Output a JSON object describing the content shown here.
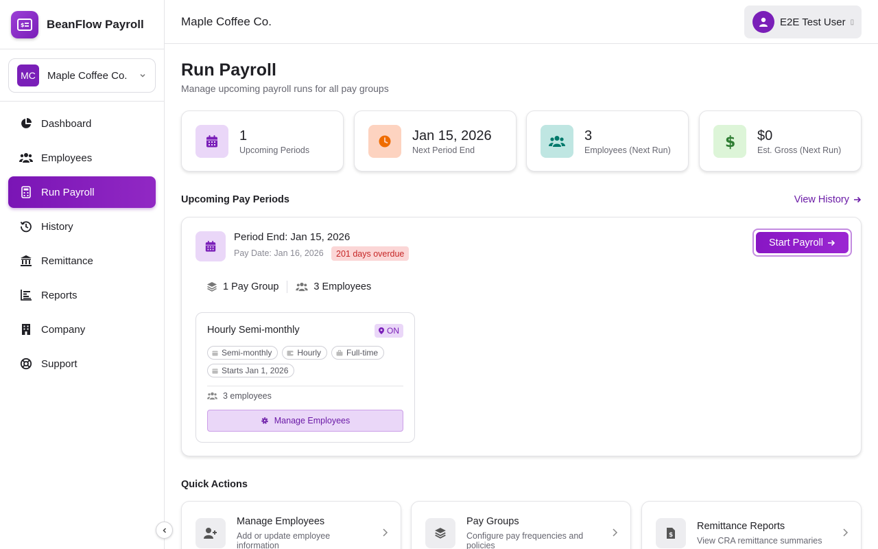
{
  "brand": {
    "name": "BeanFlow Payroll",
    "logo_icon": "payroll-card-icon"
  },
  "company_selector": {
    "initials": "MC",
    "name": "Maple Coffee Co."
  },
  "nav": {
    "items": [
      {
        "label": "Dashboard",
        "icon": "pie-chart-icon",
        "active": false
      },
      {
        "label": "Employees",
        "icon": "users-icon",
        "active": false
      },
      {
        "label": "Run Payroll",
        "icon": "calculator-icon",
        "active": true
      },
      {
        "label": "History",
        "icon": "history-icon",
        "active": false
      },
      {
        "label": "Remittance",
        "icon": "bank-icon",
        "active": false
      },
      {
        "label": "Reports",
        "icon": "bar-chart-icon",
        "active": false
      },
      {
        "label": "Company",
        "icon": "building-icon",
        "active": false
      },
      {
        "label": "Support",
        "icon": "lifebuoy-icon",
        "active": false
      }
    ]
  },
  "header": {
    "title": "Maple Coffee Co.",
    "user_name": "E2E Test User",
    "user_caret": "▯"
  },
  "page": {
    "title": "Run Payroll",
    "subtitle": "Manage upcoming payroll runs for all pay groups"
  },
  "stats": [
    {
      "value": "1",
      "label": "Upcoming Periods",
      "icon": "calendar-icon"
    },
    {
      "value": "Jan 15, 2026",
      "label": "Next Period End",
      "icon": "clock-icon"
    },
    {
      "value": "3",
      "label": "Employees (Next Run)",
      "icon": "users-icon"
    },
    {
      "value": "$0",
      "label": "Est. Gross (Next Run)",
      "icon": "dollar-icon"
    }
  ],
  "upcoming": {
    "section_title": "Upcoming Pay Periods",
    "view_history_label": "View History",
    "period": {
      "period_end": "Period End: Jan 15, 2026",
      "pay_date": "Pay Date: Jan 16, 2026",
      "overdue_badge": "201 days overdue",
      "start_button": "Start Payroll",
      "pay_group_count": "1 Pay Group",
      "employee_count": "3 Employees",
      "group": {
        "name": "Hourly Semi-monthly",
        "province_badge": "ON",
        "chips": [
          "Semi-monthly",
          "Hourly",
          "Full-time",
          "Starts Jan 1, 2026"
        ],
        "employees": "3 employees",
        "manage_button": "Manage Employees"
      }
    }
  },
  "quick_actions": {
    "section_title": "Quick Actions",
    "items": [
      {
        "title": "Manage Employees",
        "description": "Add or update employee information",
        "icon": "user-plus-icon"
      },
      {
        "title": "Pay Groups",
        "description": "Configure pay frequencies and policies",
        "icon": "layers-icon"
      },
      {
        "title": "Remittance Reports",
        "description": "View CRA remittance summaries",
        "icon": "file-dollar-icon"
      }
    ]
  },
  "colors": {
    "primary": "#7a1fb8",
    "overdue_bg": "#fbd6d6",
    "overdue_text": "#c62828",
    "stat_purple_bg": "#ead7f8",
    "stat_orange_bg": "#fdd3c0",
    "stat_teal_bg": "#bfe6e2",
    "stat_green_bg": "#ddf5d8"
  }
}
